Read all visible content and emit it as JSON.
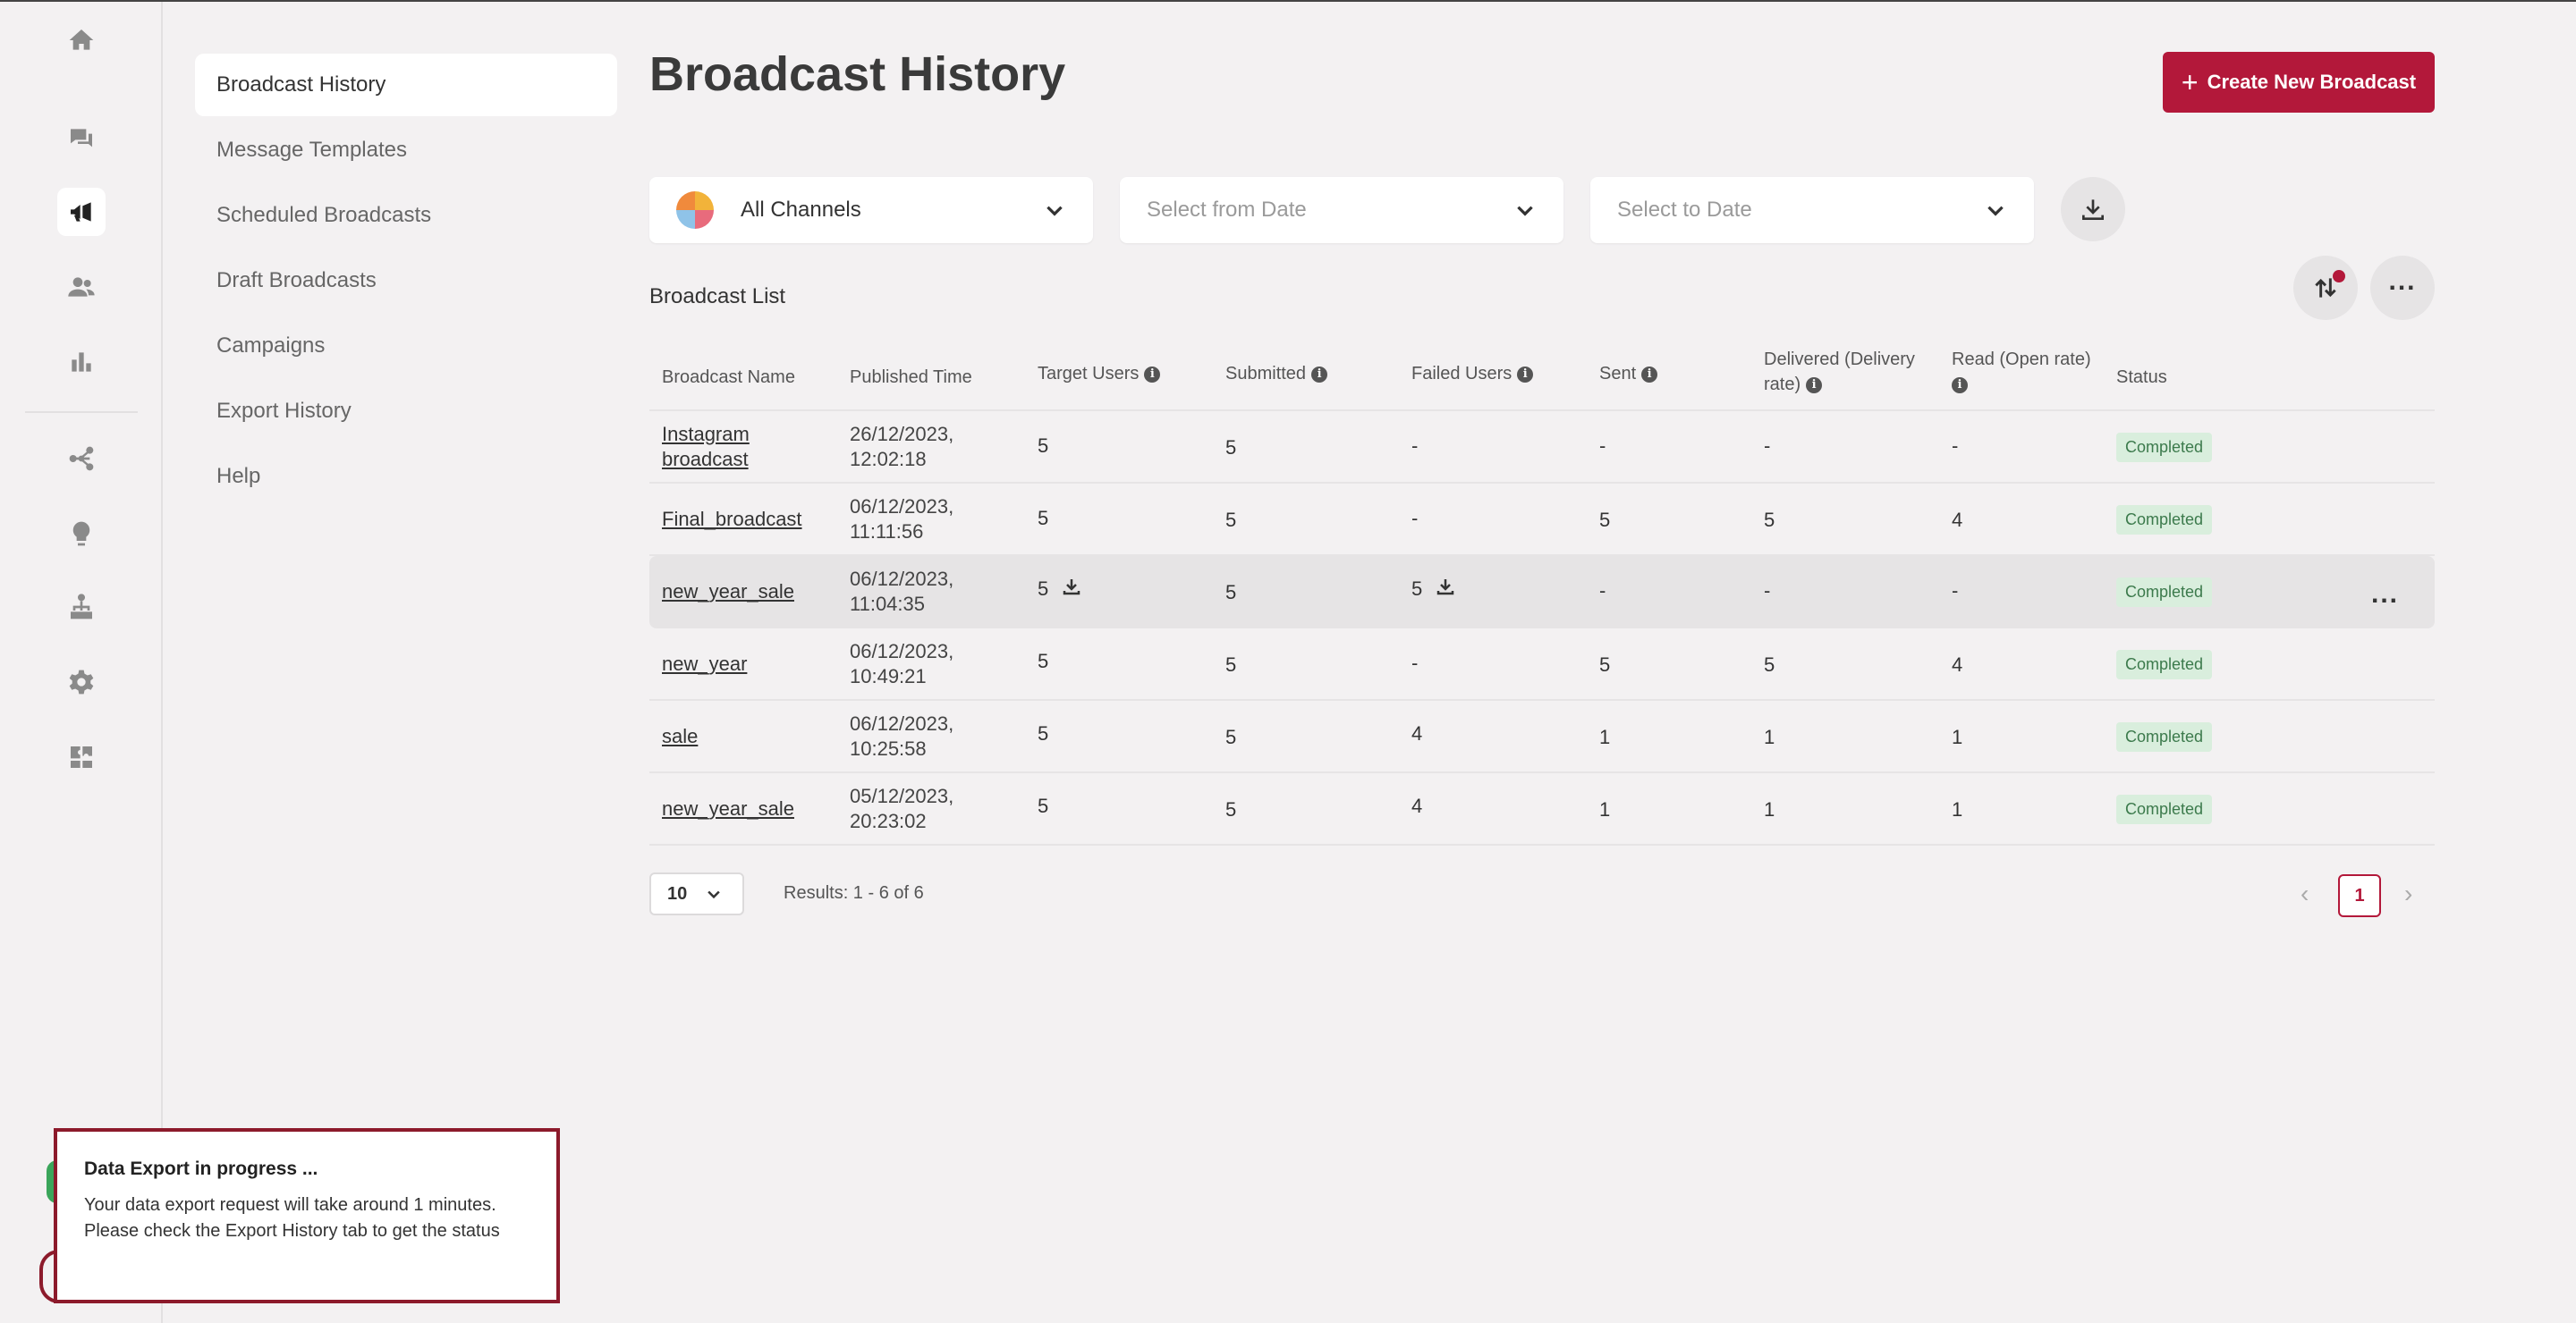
{
  "sidebar_nav": {
    "items": [
      {
        "label": "Broadcast History",
        "active": true
      },
      {
        "label": "Message Templates"
      },
      {
        "label": "Scheduled Broadcasts"
      },
      {
        "label": "Draft Broadcasts"
      },
      {
        "label": "Campaigns"
      },
      {
        "label": "Export History"
      },
      {
        "label": "Help"
      }
    ]
  },
  "rail_icons": [
    "home-icon",
    "chat-icon",
    "megaphone-icon",
    "contacts-icon",
    "analytics-icon",
    "flow-icon",
    "bulb-icon",
    "org-tree-icon",
    "gear-icon",
    "integrations-icon"
  ],
  "header": {
    "title": "Broadcast History",
    "create_button": "Create New Broadcast"
  },
  "filters": {
    "channel": "All Channels",
    "from_date_placeholder": "Select from Date",
    "to_date_placeholder": "Select to Date"
  },
  "list_title": "Broadcast List",
  "table": {
    "columns": [
      "Broadcast Name",
      "Published Time",
      "Target Users",
      "Submitted",
      "Failed Users",
      "Sent",
      "Delivered (Delivery",
      "rate)",
      "Read (Open rate)",
      "Status"
    ],
    "rows": [
      {
        "name_1": "Instagram",
        "name_2": "broadcast",
        "time_1": "26/12/2023,",
        "time_2": "12:02:18",
        "target": "5",
        "submitted": "5",
        "failed": "-",
        "sent": "-",
        "delivered": "-",
        "read": "-",
        "status": "Completed"
      },
      {
        "name_1": "Final_broadcast",
        "name_2": "",
        "time_1": "06/12/2023,",
        "time_2": "11:11:56",
        "target": "5",
        "submitted": "5",
        "failed": "-",
        "sent": "5",
        "delivered": "5",
        "read": "4",
        "status": "Completed"
      },
      {
        "name_1": "new_year_sale",
        "name_2": "",
        "time_1": "06/12/2023,",
        "time_2": "11:04:35",
        "target": "5",
        "submitted": "5",
        "failed": "5",
        "sent": "-",
        "delivered": "-",
        "read": "-",
        "status": "Completed"
      },
      {
        "name_1": "new_year",
        "name_2": "",
        "time_1": "06/12/2023,",
        "time_2": "10:49:21",
        "target": "5",
        "submitted": "5",
        "failed": "-",
        "sent": "5",
        "delivered": "5",
        "read": "4",
        "status": "Completed"
      },
      {
        "name_1": "sale",
        "name_2": "",
        "time_1": "06/12/2023,",
        "time_2": "10:25:58",
        "target": "5",
        "submitted": "5",
        "failed": "4",
        "sent": "1",
        "delivered": "1",
        "read": "1",
        "status": "Completed"
      },
      {
        "name_1": "new_year_sale",
        "name_2": "",
        "time_1": "05/12/2023,",
        "time_2": "20:23:02",
        "target": "5",
        "submitted": "5",
        "failed": "4",
        "sent": "1",
        "delivered": "1",
        "read": "1",
        "status": "Completed"
      }
    ]
  },
  "pagination": {
    "page_size": "10",
    "results": "Results: 1 - 6 of 6",
    "current_page": "1"
  },
  "toast": {
    "title": "Data Export in progress ...",
    "body": "Your data export request will take around 1 minutes. Please check the Export History tab to get the status"
  },
  "colors": {
    "accent": "#b3183a",
    "badge_bg": "#d9eedd",
    "badge_text": "#3c7a4c",
    "background": "#f3f1f2"
  }
}
